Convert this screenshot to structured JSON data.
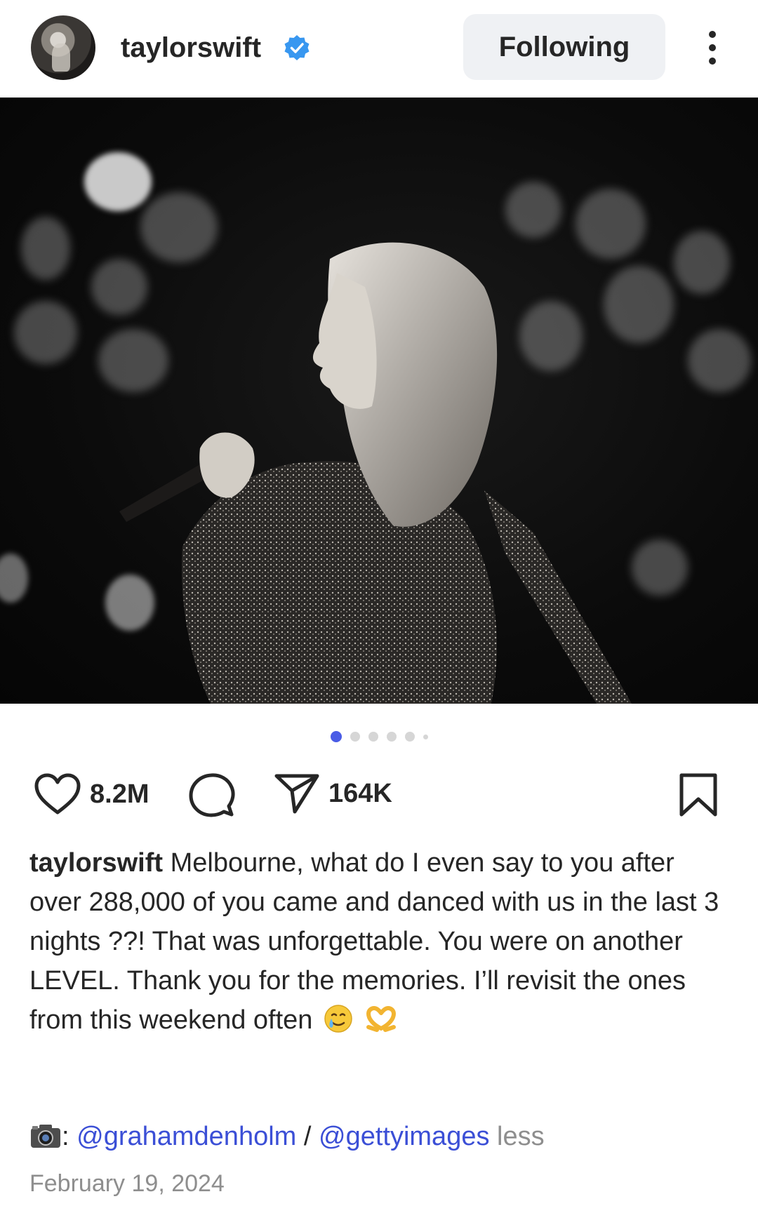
{
  "header": {
    "username": "taylorswift",
    "verified_icon": "verified-badge-icon",
    "follow_label": "Following",
    "more_icon": "more-vertical-icon"
  },
  "carousel": {
    "total_slides": 6,
    "active_index": 0,
    "active_color": "#4a5ce6"
  },
  "actions": {
    "like_icon": "heart-icon",
    "likes": "8.2M",
    "comment_icon": "comment-icon",
    "share_icon": "send-icon",
    "shares": "164K",
    "save_icon": "bookmark-icon"
  },
  "caption": {
    "username": "taylorswift",
    "text": "Melbourne, what do I even say to you after over 288,000 of you came and danced with us in the last 3 nights ??! That was unforgettable. You were on another LEVEL. Thank you for the memories. I’ll revisit the ones from this weekend often"
  },
  "credits": {
    "camera_icon": "camera-icon",
    "prefix": ":",
    "mention1": "@grahamdenholm",
    "separator": " / ",
    "mention2": "@gettyimages",
    "less_label": "less"
  },
  "date": "February 19, 2024",
  "colors": {
    "text": "#262626",
    "link": "#3b4fd6",
    "muted": "#8e8e8e",
    "button_bg": "#eff1f4",
    "verified": "#3897f0"
  }
}
